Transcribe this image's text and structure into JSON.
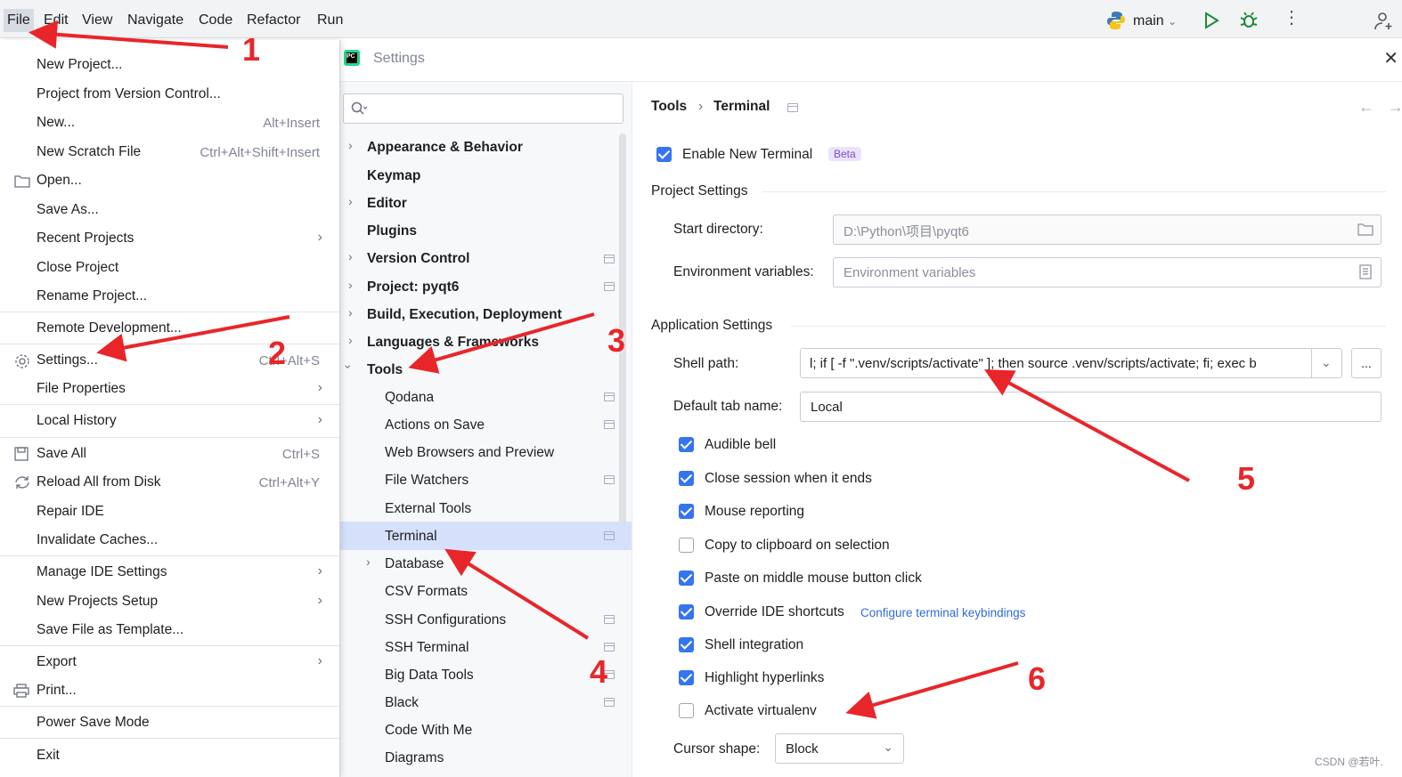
{
  "menubar": {
    "items": [
      "File",
      "Edit",
      "View",
      "Navigate",
      "Code",
      "Refactor",
      "Run"
    ],
    "branch": "main"
  },
  "file_menu": {
    "items": [
      {
        "label": "New Project...",
        "shortcut": ""
      },
      {
        "label": "Project from Version Control...",
        "shortcut": ""
      },
      {
        "label": "New...",
        "shortcut": "Alt+Insert"
      },
      {
        "label": "New Scratch File",
        "shortcut": "Ctrl+Alt+Shift+Insert"
      },
      {
        "label": "Open...",
        "shortcut": ""
      },
      {
        "label": "Save As...",
        "shortcut": ""
      },
      {
        "label": "Recent Projects",
        "shortcut": ""
      },
      {
        "label": "Close Project",
        "shortcut": ""
      },
      {
        "label": "Rename Project...",
        "shortcut": ""
      },
      {
        "label": "Remote Development...",
        "shortcut": ""
      },
      {
        "label": "Settings...",
        "shortcut": "Ctrl+Alt+S"
      },
      {
        "label": "File Properties",
        "shortcut": ""
      },
      {
        "label": "Local History",
        "shortcut": ""
      },
      {
        "label": "Save All",
        "shortcut": "Ctrl+S"
      },
      {
        "label": "Reload All from Disk",
        "shortcut": "Ctrl+Alt+Y"
      },
      {
        "label": "Repair IDE",
        "shortcut": ""
      },
      {
        "label": "Invalidate Caches...",
        "shortcut": ""
      },
      {
        "label": "Manage IDE Settings",
        "shortcut": ""
      },
      {
        "label": "New Projects Setup",
        "shortcut": ""
      },
      {
        "label": "Save File as Template...",
        "shortcut": ""
      },
      {
        "label": "Export",
        "shortcut": ""
      },
      {
        "label": "Print...",
        "shortcut": ""
      },
      {
        "label": "Power Save Mode",
        "shortcut": ""
      },
      {
        "label": "Exit",
        "shortcut": ""
      }
    ]
  },
  "settings": {
    "title": "Settings",
    "search_placeholder": "",
    "tree": [
      "Appearance & Behavior",
      "Keymap",
      "Editor",
      "Plugins",
      "Version Control",
      "Project: pyqt6",
      "Build, Execution, Deployment",
      "Languages & Frameworks",
      "Tools",
      "Qodana",
      "Actions on Save",
      "Web Browsers and Preview",
      "File Watchers",
      "External Tools",
      "Terminal",
      "Database",
      "CSV Formats",
      "SSH Configurations",
      "SSH Terminal",
      "Big Data Tools",
      "Black",
      "Code With Me",
      "Diagrams"
    ],
    "breadcrumb": {
      "parent": "Tools",
      "current": "Terminal"
    },
    "enable_new_terminal": {
      "label": "Enable New Terminal",
      "checked": true,
      "badge": "Beta"
    },
    "project_settings": {
      "heading": "Project Settings",
      "start_directory_label": "Start directory:",
      "start_directory_value": "D:\\Python\\项目\\pyqt6",
      "env_label": "Environment variables:",
      "env_placeholder": "Environment variables"
    },
    "app_settings": {
      "heading": "Application Settings",
      "shell_path_label": "Shell path:",
      "shell_path_value": "l; if [ -f \".venv/scripts/activate\" ]; then  source .venv/scripts/activate; fi; exec b",
      "browse": "...",
      "default_tab_label": "Default tab name:",
      "default_tab_value": "Local",
      "options": [
        {
          "label": "Audible bell",
          "checked": true
        },
        {
          "label": "Close session when it ends",
          "checked": true
        },
        {
          "label": "Mouse reporting",
          "checked": true
        },
        {
          "label": "Copy to clipboard on selection",
          "checked": false
        },
        {
          "label": "Paste on middle mouse button click",
          "checked": true
        },
        {
          "label": "Override IDE shortcuts",
          "checked": true
        },
        {
          "label": "Shell integration",
          "checked": true
        },
        {
          "label": "Highlight hyperlinks",
          "checked": true
        },
        {
          "label": "Activate virtualenv",
          "checked": false
        }
      ],
      "keybindings_link": "Configure terminal keybindings",
      "cursor_shape_label": "Cursor shape:",
      "cursor_shape_value": "Block"
    }
  },
  "annotations": [
    "1",
    "2",
    "3",
    "4",
    "5",
    "6"
  ],
  "watermark": "CSDN @若叶.",
  "colors": {
    "accent": "#3574f0",
    "selected_row": "#d5e1fb",
    "arrow": "#e8262a",
    "beta_badge_bg": "#ebe3fb",
    "beta_badge_fg": "#7b4fd6"
  }
}
